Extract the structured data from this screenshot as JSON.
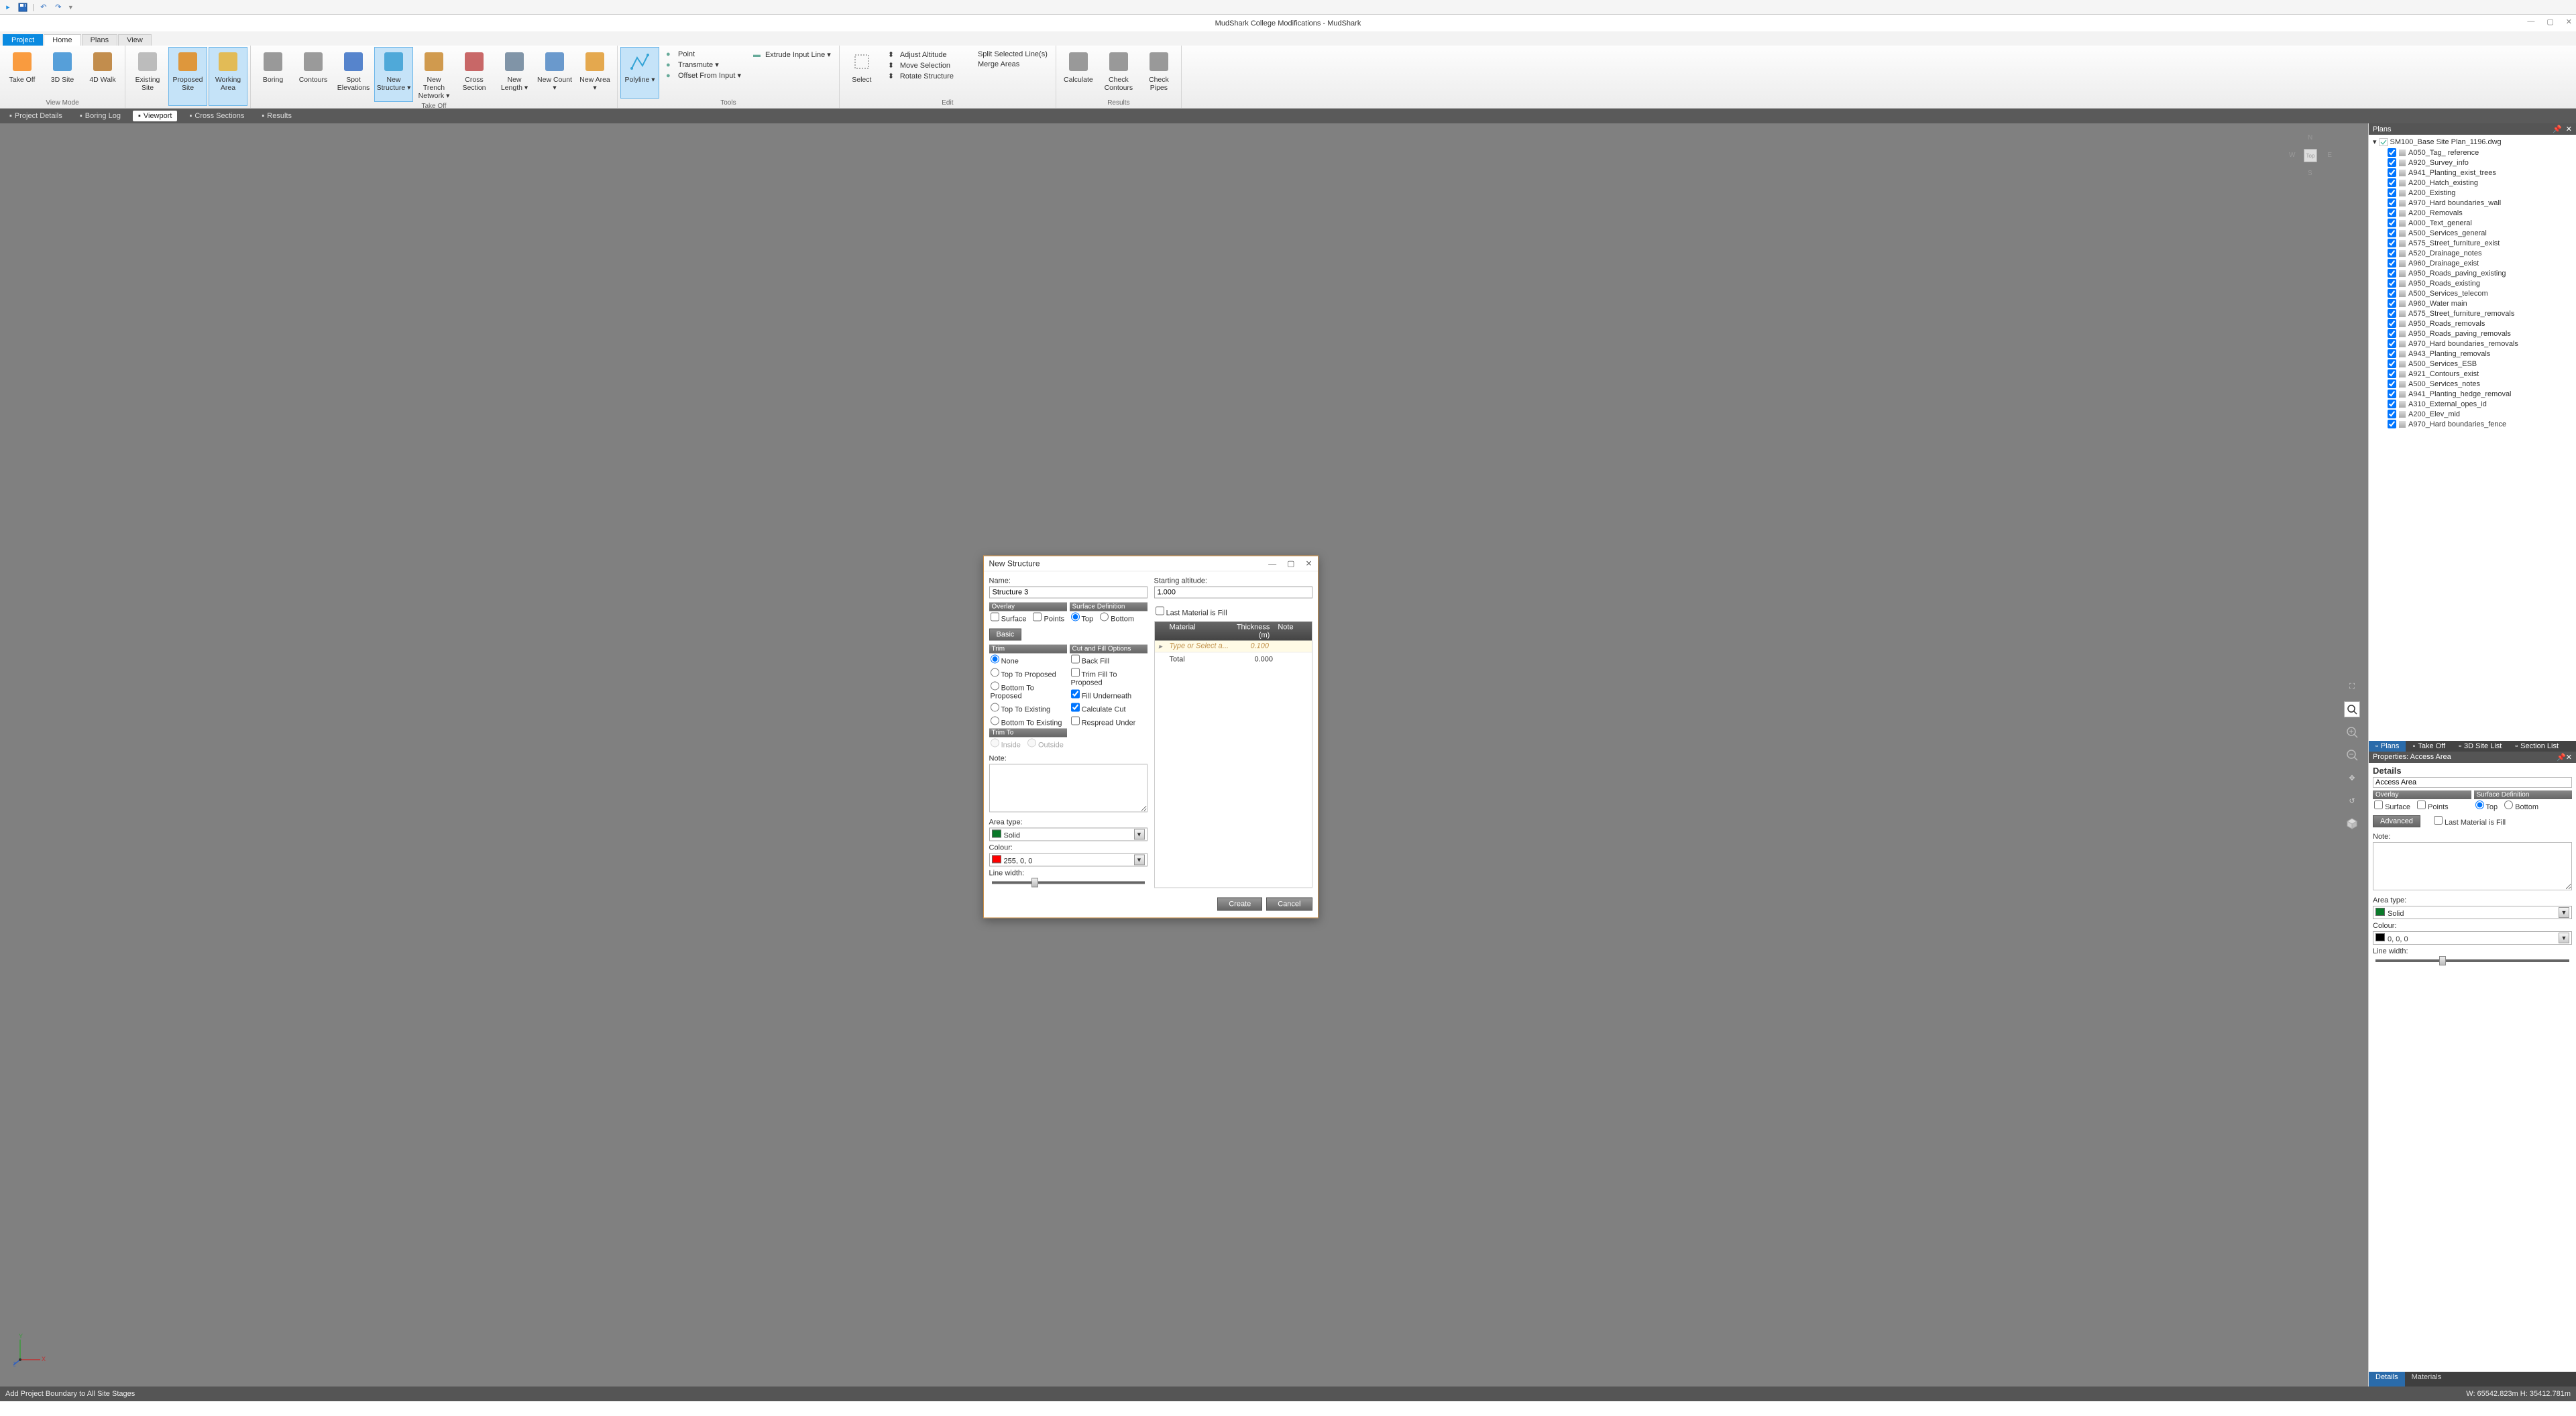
{
  "app_title": "MudShark College Modifications - MudShark",
  "menu_tabs": [
    "Project",
    "Home",
    "Plans",
    "View"
  ],
  "ribbon": {
    "groups": [
      {
        "label": "View Mode",
        "items": [
          {
            "name": "take-off",
            "label": "Take Off",
            "color": "#f98b1e"
          },
          {
            "name": "3d-site",
            "label": "3D Site",
            "color": "#3a8fd4"
          },
          {
            "name": "4d-walk",
            "label": "4D Walk",
            "color": "#b97a2f"
          }
        ]
      },
      {
        "label": "",
        "items": [
          {
            "name": "existing-site",
            "label": "Existing Site",
            "color": "#b1b1b1"
          },
          {
            "name": "proposed-site",
            "label": "Proposed Site",
            "color": "#e28a1b",
            "active": true
          },
          {
            "name": "working-area",
            "label": "Working Area",
            "color": "#e6b43a",
            "active": true
          }
        ]
      },
      {
        "label": "Take Off",
        "items": [
          {
            "name": "boring",
            "label": "Boring",
            "color": "#888"
          },
          {
            "name": "contours",
            "label": "Contours",
            "color": "#8a8a8a"
          },
          {
            "name": "spot-elevations",
            "label": "Spot Elevations",
            "color": "#3a70c4"
          },
          {
            "name": "new-structure",
            "label": "New Structure ▾",
            "color": "#3a9fd4",
            "active": true
          },
          {
            "name": "new-trench",
            "label": "New Trench Network ▾",
            "color": "#c98a30"
          },
          {
            "name": "cross-section",
            "label": "Cross Section",
            "color": "#bf4d4d"
          },
          {
            "name": "new-length",
            "label": "New Length ▾",
            "color": "#6b8299"
          },
          {
            "name": "new-count",
            "label": "New Count ▾",
            "color": "#5188c4"
          },
          {
            "name": "new-area",
            "label": "New Area ▾",
            "color": "#e09a30"
          }
        ]
      },
      {
        "label": "Tools",
        "mode": "column",
        "items": [
          {
            "name": "polyline",
            "label": "Polyline ▾",
            "color": "#34a4d6",
            "big": true,
            "active": true
          },
          {
            "name": "point",
            "label": "Point"
          },
          {
            "name": "transmute",
            "label": "Transmute ▾"
          },
          {
            "name": "offset",
            "label": "Offset From Input ▾"
          },
          {
            "name": "extrude",
            "label": "Extrude Input Line ▾"
          }
        ]
      },
      {
        "label": "Edit",
        "items": [
          {
            "name": "select",
            "label": "Select",
            "big": true
          },
          {
            "name": "adjust-altitude",
            "label": "Adjust Altitude"
          },
          {
            "name": "move-selection",
            "label": "Move Selection"
          },
          {
            "name": "rotate-structure",
            "label": "Rotate Structure"
          },
          {
            "name": "split-lines",
            "label": "Split Selected Line(s)"
          },
          {
            "name": "merge-areas",
            "label": "Merge Areas"
          }
        ]
      },
      {
        "label": "Results",
        "items": [
          {
            "name": "calculate",
            "label": "Calculate",
            "big": true
          },
          {
            "name": "check-contours",
            "label": "Check Contours",
            "big": true
          },
          {
            "name": "check-pipes",
            "label": "Check Pipes",
            "big": true
          }
        ]
      }
    ]
  },
  "sub_bar": [
    {
      "label": "Project Details",
      "icon": "doc"
    },
    {
      "label": "Boring Log",
      "icon": "log"
    },
    {
      "label": "Viewport",
      "icon": "vp",
      "active": true
    },
    {
      "label": "Cross Sections",
      "icon": "cs"
    },
    {
      "label": "Results",
      "icon": "res"
    }
  ],
  "viewport": {
    "compass": {
      "n": "N",
      "s": "S",
      "e": "E",
      "w": "W",
      "center": "Top"
    },
    "axis": {
      "x": "X",
      "y": "Y",
      "z": "Z"
    }
  },
  "plans_panel": {
    "title": "Plans",
    "root": "SM100_Base Site Plan_1196.dwg",
    "layers": [
      "A050_Tag_ reference",
      "A920_Survey_info",
      "A941_Planting_exist_trees",
      "A200_Hatch_existing",
      "A200_Existing",
      "A970_Hard boundaries_wall",
      "A200_Removals",
      "A000_Text_general",
      "A500_Services_general",
      "A575_Street_furniture_exist",
      "A520_Drainage_notes",
      "A960_Drainage_exist",
      "A950_Roads_paving_existing",
      "A950_Roads_existing",
      "A500_Services_telecom",
      "A960_Water main",
      "A575_Street_furniture_removals",
      "A950_Roads_removals",
      "A950_Roads_paving_removals",
      "A970_Hard boundaries_removals",
      "A943_Planting_removals",
      "A500_Services_ESB",
      "A921_Contours_exist",
      "A500_Services_notes",
      "A941_Planting_hedge_removal",
      "A310_External_opes_id",
      "A200_Elev_mid",
      "A970_Hard boundaries_fence"
    ]
  },
  "list_tabs": [
    {
      "label": "Plans",
      "active": true
    },
    {
      "label": "Take Off"
    },
    {
      "label": "3D Site List"
    },
    {
      "label": "Section List"
    }
  ],
  "props": {
    "title": "Properties: Access Area",
    "details_h": "Details",
    "name_value": "Access Area",
    "overlay_h": "Overlay",
    "surfdef_h": "Surface Definition",
    "surface_cb": "Surface",
    "points_cb": "Points",
    "top_r": "Top",
    "bottom_r": "Bottom",
    "advanced_btn": "Advanced",
    "last_mat": "Last Material is Fill",
    "note_l": "Note:",
    "area_type_l": "Area type:",
    "area_type_v": "Solid",
    "colour_l": "Colour:",
    "colour_v": "0, 0, 0",
    "linew_l": "Line width:"
  },
  "status_left": "Add Project Boundary to All Site Stages",
  "status_right": "W: 65542.823m  H: 35412.781m",
  "bottom_tabs": [
    "Details",
    "Materials"
  ],
  "dialog": {
    "title": "New Structure",
    "name_l": "Name:",
    "name_v": "Structure 3",
    "alt_l": "Starting altitude:",
    "alt_v": "1.000",
    "overlay_h": "Overlay",
    "surface_cb": "Surface",
    "points_cb": "Points",
    "surfdef_h": "Surface Definition",
    "top_r": "Top",
    "bottom_r": "Bottom",
    "basic_btn": "Basic",
    "last_mat": "Last Material is Fill",
    "trim_h": "Trim",
    "trim_items": [
      "None",
      "Top To Proposed",
      "Bottom To Proposed",
      "Top To Existing",
      "Bottom To Existing"
    ],
    "trimto_h": "Trim To",
    "trimto_items": [
      "Inside",
      "Outside"
    ],
    "cutfill_h": "Cut and Fill Options",
    "cf_items": [
      "Back Fill",
      "Trim Fill To Proposed",
      "Fill Underneath",
      "Calculate Cut",
      "Respread Under"
    ],
    "note_l": "Note:",
    "area_type_l": "Area type:",
    "area_type_v": "Solid",
    "colour_l": "Colour:",
    "colour_v": "255, 0, 0",
    "linew_l": "Line width:",
    "mat_headers": [
      "Material",
      "Thickness (m)",
      "Note"
    ],
    "mat_hint": "Type or Select a...",
    "mat_hint_thk": "0.100",
    "total_l": "Total",
    "total_v": "0.000",
    "create": "Create",
    "cancel": "Cancel"
  }
}
